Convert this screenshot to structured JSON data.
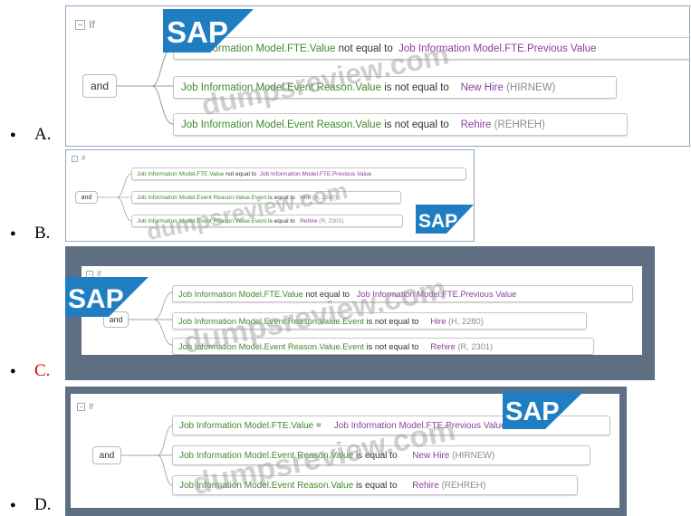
{
  "logo_text": "SAP",
  "watermark_text": "dumpsreview.com",
  "colors": {
    "correct_letter": "#e10000",
    "field_text": "#3f8a2f",
    "value_text": "#8a3f9e",
    "frame": "#5e6f83",
    "sap_blue": "#1f7ec2"
  },
  "options": [
    {
      "letter": "A.",
      "is_correct": false,
      "if_label": "If",
      "and_label": "and",
      "conditions": [
        {
          "field": "Job Information Model.FTE.Value",
          "operator": "not equal to",
          "value": "Job Information Model.FTE.Previous Value",
          "code": ""
        },
        {
          "field": "Job Information Model.Event Reason.Value",
          "operator": "is not equal to",
          "value": "New Hire",
          "code": "(HIRNEW)"
        },
        {
          "field": "Job Information Model.Event Reason.Value",
          "operator": "is not equal to",
          "value": "Rehire",
          "code": "(REHREH)"
        }
      ]
    },
    {
      "letter": "B.",
      "is_correct": false,
      "if_label": "If",
      "and_label": "and",
      "conditions": [
        {
          "field": "Job Information Model.FTE.Value",
          "operator": "not equal to",
          "value": "Job Information Model.FTE.Previous Value",
          "code": ""
        },
        {
          "field": "Job Information Model.Event Reason.Value.Event",
          "operator": "is equal to",
          "value": "Hire",
          "code": "(H, 2280)"
        },
        {
          "field": "Job Information Model.Event Reason.Value.Event",
          "operator": "is equal to",
          "value": "Rehire",
          "code": "(R, 2301)"
        }
      ]
    },
    {
      "letter": "C.",
      "is_correct": true,
      "if_label": "If",
      "and_label": "and",
      "conditions": [
        {
          "field": "Job Information Model.FTE.Value",
          "operator": "not equal to",
          "value": "Job Information Model.FTE.Previous Value",
          "code": ""
        },
        {
          "field": "Job Information Model.Event Reason.Value.Event",
          "operator": "is not equal to",
          "value": "Hire",
          "code": "(H, 2280)"
        },
        {
          "field": "Job Information Model.Event Reason.Value.Event",
          "operator": "is not equal to",
          "value": "Rehire",
          "code": "(R, 2301)"
        }
      ]
    },
    {
      "letter": "D.",
      "is_correct": false,
      "if_label": "If",
      "and_label": "and",
      "conditions": [
        {
          "field": "Job Information Model.FTE.Value",
          "operator": "=",
          "value": "Job Information Model.FTE.Previous Value",
          "code": ""
        },
        {
          "field": "Job Information Model.Event Reason.Value",
          "operator": "is equal to",
          "value": "New Hire",
          "code": "(HIRNEW)"
        },
        {
          "field": "Job Information Model.Event Reason.Value",
          "operator": "is equal to",
          "value": "Rehire",
          "code": "(REHREH)"
        }
      ]
    }
  ]
}
